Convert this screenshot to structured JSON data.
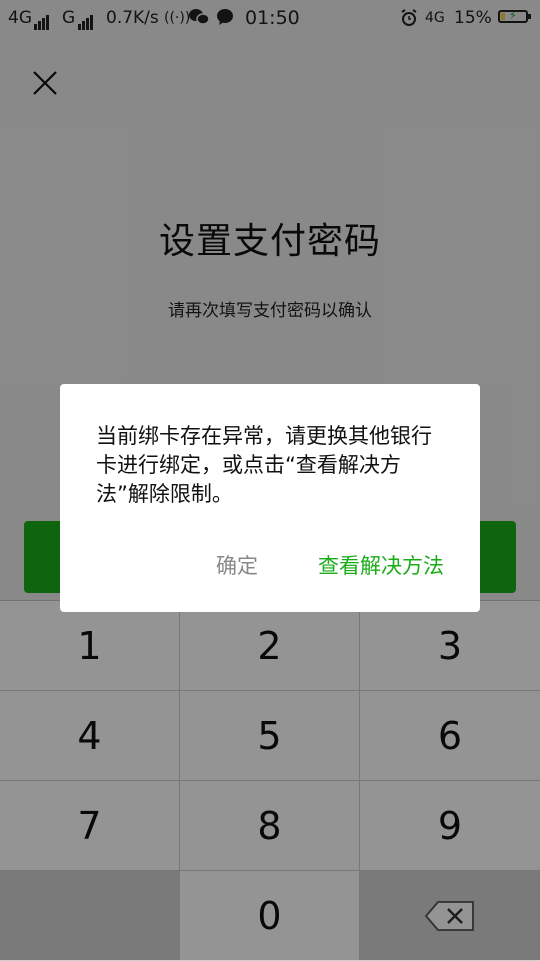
{
  "status_bar": {
    "sim1": "4G",
    "sim2": "G",
    "speed": "0.7K/s",
    "time": "01:50",
    "network_right": "4G",
    "battery": "15%",
    "battery_level": 0.15
  },
  "page": {
    "title": "设置支付密码",
    "subtitle": "请再次填写支付密码以确认"
  },
  "keypad": {
    "keys": [
      "1",
      "2",
      "3",
      "4",
      "5",
      "6",
      "7",
      "8",
      "9",
      "",
      "0",
      ""
    ]
  },
  "dialog": {
    "message": "当前绑卡存在异常，请更换其他银行卡进行绑定，或点击“查看解决方法”解除限制。",
    "ok_label": "确定",
    "solution_label": "查看解决方法"
  },
  "colors": {
    "accent": "#1aad19",
    "mask": "rgba(0,0,0,0.42)"
  }
}
